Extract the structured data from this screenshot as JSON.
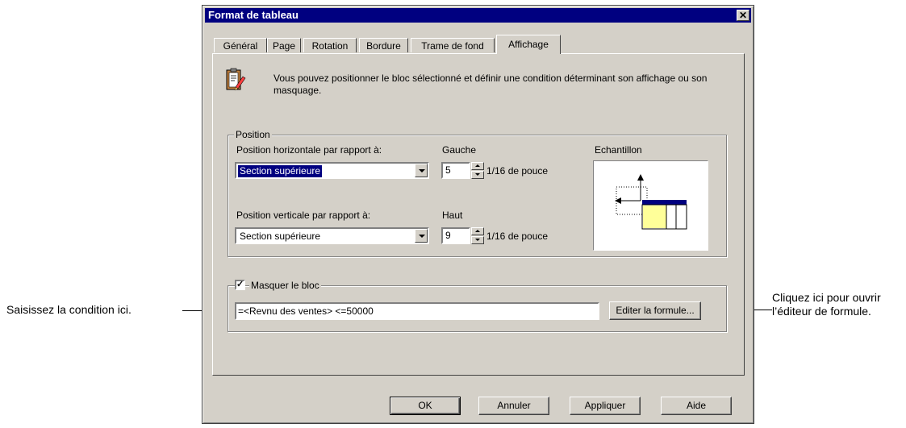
{
  "dialog": {
    "title": "Format de tableau",
    "close_glyph": "✕"
  },
  "tabs": [
    {
      "label": "Général"
    },
    {
      "label": "Page"
    },
    {
      "label": "Rotation"
    },
    {
      "label": "Bordure"
    },
    {
      "label": "Trame de fond"
    },
    {
      "label": "Affichage"
    }
  ],
  "intro": {
    "icon": "clipboard-pencil-icon",
    "text": "Vous pouvez positionner le bloc sélectionné et définir une condition déterminant son affichage ou son masquage."
  },
  "position": {
    "group_label": "Position",
    "horizontal_label": "Position horizontale par rapport à:",
    "horizontal_value": "Section supérieure",
    "vertical_label": "Position verticale par rapport à:",
    "vertical_value": "Section supérieure",
    "left_label": "Gauche",
    "left_value": "5",
    "top_label": "Haut",
    "top_value": "9",
    "unit": "1/16 de pouce",
    "sample_label": "Echantillon"
  },
  "mask": {
    "checkbox_label": "Masquer le bloc",
    "checked": true,
    "check_glyph": "✓",
    "formula": "=<Revnu des ventes> <=50000",
    "edit_button": "Editer la formule..."
  },
  "buttons": {
    "ok": "OK",
    "cancel": "Annuler",
    "apply": "Appliquer",
    "help": "Aide"
  },
  "annotations": {
    "left": "Saisissez la condition ici.",
    "right": "Cliquez ici pour ouvrir l’éditeur de formule."
  },
  "colors": {
    "title_bar": "#000080",
    "dialog_face": "#d4d0c8",
    "sample_fill": "#ffff99",
    "sample_header": "#000080"
  }
}
